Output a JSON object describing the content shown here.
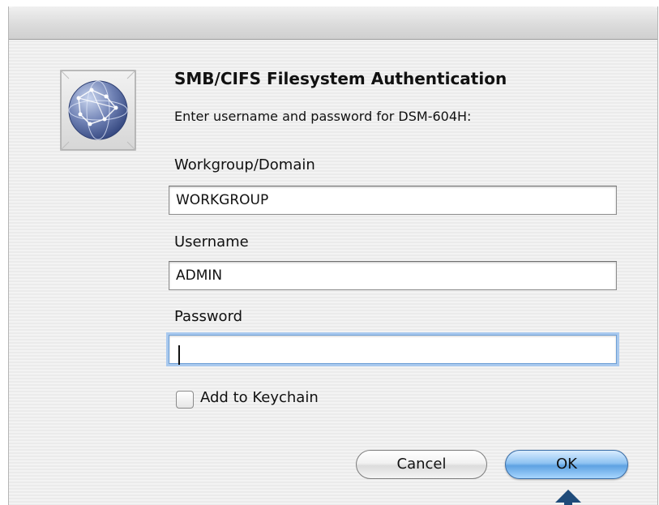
{
  "dialog": {
    "title": "SMB/CIFS Filesystem Authentication",
    "subtitle": "Enter username and password for DSM-604H:",
    "workgroup": {
      "label": "Workgroup/Domain",
      "value": "WORKGROUP"
    },
    "username": {
      "label": "Username",
      "value": "ADMIN"
    },
    "password": {
      "label": "Password",
      "value": ""
    },
    "keychain": {
      "label": "Add to Keychain",
      "checked": false
    },
    "buttons": {
      "cancel": "Cancel",
      "ok": "OK"
    }
  },
  "icons": {
    "app": "network-globe-icon",
    "pointer": "up-arrow-icon"
  },
  "colors": {
    "ok_button": "#5ea2e2",
    "focus_ring": "#a9c9ee",
    "pointer_arrow": "#1f4b7a"
  }
}
